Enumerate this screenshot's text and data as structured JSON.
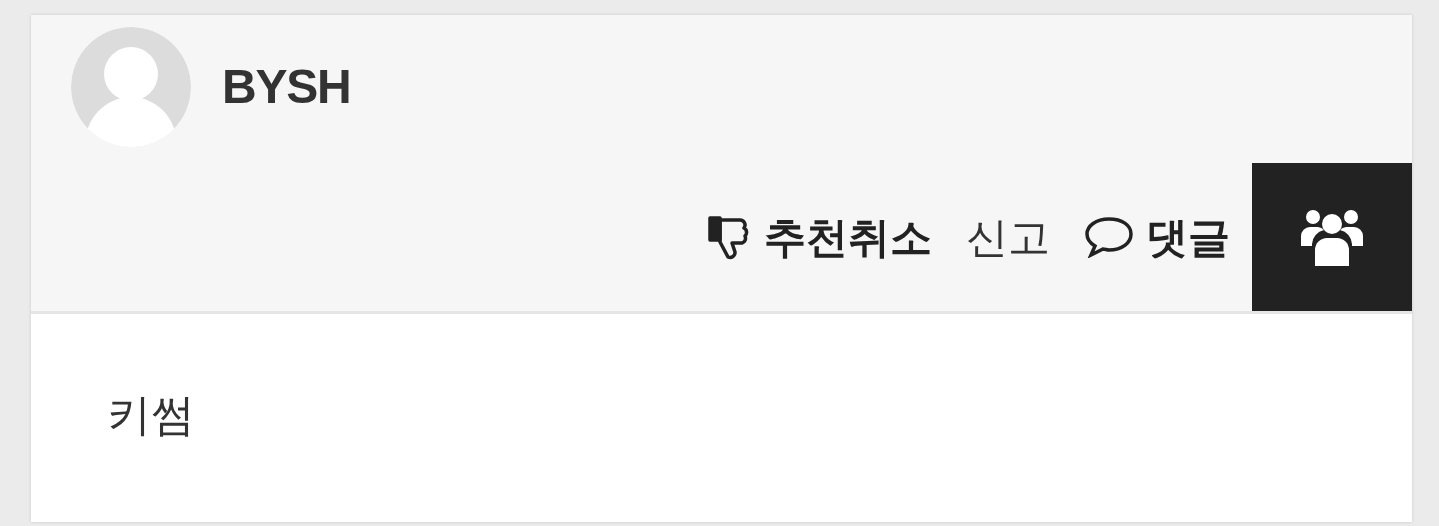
{
  "post": {
    "author": "BYSH",
    "actions": [
      {
        "kind": "vote",
        "label": "추천취소"
      },
      {
        "kind": "report",
        "label": "신고"
      },
      {
        "kind": "comment",
        "label": "댓글"
      }
    ],
    "body": "키썸"
  }
}
